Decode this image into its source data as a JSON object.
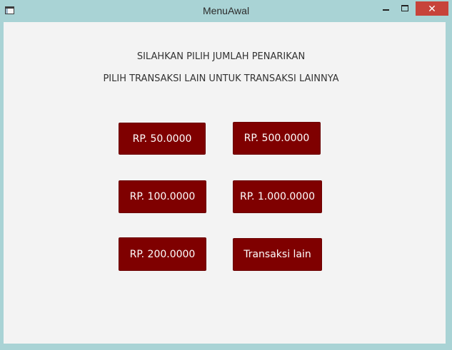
{
  "window": {
    "title": "MenuAwal",
    "close_label": "✕"
  },
  "messages": {
    "line1": "SILAHKAN PILIH JUMLAH PENARIKAN",
    "line2": "PILIH TRANSAKSI LAIN UNTUK TRANSAKSI LAINNYA"
  },
  "buttons": [
    {
      "label": "RP. 50.0000"
    },
    {
      "label": "RP. 500.0000"
    },
    {
      "label": "RP. 100.0000"
    },
    {
      "label": "RP. 1.000.0000"
    },
    {
      "label": "RP. 200.0000"
    },
    {
      "label": "Transaksi lain"
    }
  ],
  "colors": {
    "button_bg": "#7f0000",
    "button_text": "#ffffff",
    "window_frame": "#a9d3d5",
    "content_bg": "#f3f3f3",
    "close_button": "#c7433a"
  }
}
